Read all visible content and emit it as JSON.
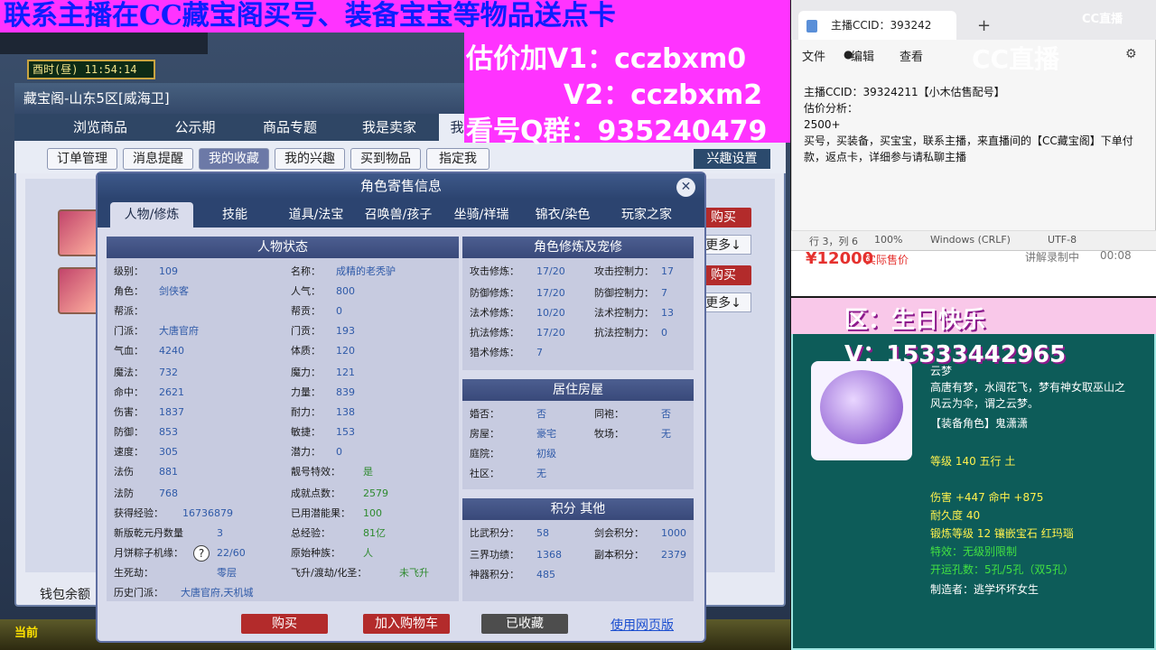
{
  "game": {
    "time_label": "酉时(昼) 11:54:14",
    "window_title": "藏宝阁-山东5区[威海卫]",
    "main_tabs": [
      "浏览商品",
      "公示期",
      "商品专题",
      "我是卖家",
      "我"
    ],
    "sub_tabs": [
      "订单管理",
      "消息提醒",
      "我的收藏",
      "我的兴趣",
      "买到物品",
      "指定我"
    ],
    "active_sub_tab": "我的收藏",
    "remind_settings": "兴趣设置",
    "side_buy": "购买",
    "side_more": "更多↓",
    "wallet_label": "钱包余额",
    "bottom_label": "当前"
  },
  "dialog": {
    "title": "角色寄售信息",
    "close": "✕",
    "tabs": [
      "人物/修炼",
      "技能",
      "道具/法宝",
      "召唤兽/孩子",
      "坐骑/祥瑞",
      "锦衣/染色",
      "玩家之家"
    ],
    "status_head": "人物状态",
    "cultivation_head": "角色修炼及宠修",
    "house_head": "居住房屋",
    "points_head": "积分 其他",
    "left_col": [
      {
        "label": "级别：",
        "value": "109"
      },
      {
        "label": "角色：",
        "value": "剑侠客"
      },
      {
        "label": "帮派：",
        "value": ""
      },
      {
        "label": "门派：",
        "value": "大唐官府"
      },
      {
        "label": "气血：",
        "value": "4240"
      },
      {
        "label": "魔法：",
        "value": "732"
      },
      {
        "label": "命中：",
        "value": "2621"
      },
      {
        "label": "伤害：",
        "value": "1837"
      },
      {
        "label": "防御：",
        "value": "853"
      },
      {
        "label": "速度：",
        "value": "305"
      },
      {
        "label": "法伤",
        "value": "881"
      },
      {
        "label": "法防",
        "value": "768"
      },
      {
        "label": "获得经验：",
        "value": "16736879"
      },
      {
        "label": "新版乾元丹数量",
        "value": "3"
      },
      {
        "label": "月饼粽子机缘：",
        "value": "22/60"
      },
      {
        "label": "生死劫：",
        "value": "零层"
      },
      {
        "label": "历史门派：",
        "value": "大唐官府,天机城"
      }
    ],
    "mid_col": [
      {
        "label": "名称：",
        "value": "成精的老秃驴"
      },
      {
        "label": "人气：",
        "value": "800"
      },
      {
        "label": "帮贡：",
        "value": "0"
      },
      {
        "label": "门贡：",
        "value": "193"
      },
      {
        "label": "体质：",
        "value": "120"
      },
      {
        "label": "魔力：",
        "value": "121"
      },
      {
        "label": "力量：",
        "value": "839"
      },
      {
        "label": "耐力：",
        "value": "138"
      },
      {
        "label": "敏捷：",
        "value": "153"
      },
      {
        "label": "潜力：",
        "value": "0"
      },
      {
        "label": "靓号特效：",
        "value": "是"
      },
      {
        "label": "成就点数：",
        "value": "2579"
      },
      {
        "label": "已用潜能果：",
        "value": "100"
      },
      {
        "label": "总经验：",
        "value": "81亿"
      },
      {
        "label": "原始种族：",
        "value": "人"
      },
      {
        "label": "飞升/渡劫/化圣：",
        "value": "未飞升"
      }
    ],
    "cultivation": [
      {
        "label": "攻击修炼：",
        "value": "17/20",
        "label2": "攻击控制力：",
        "value2": "17"
      },
      {
        "label": "防御修炼：",
        "value": "17/20",
        "label2": "防御控制力：",
        "value2": "7"
      },
      {
        "label": "法术修炼：",
        "value": "10/20",
        "label2": "法术控制力：",
        "value2": "13"
      },
      {
        "label": "抗法修炼：",
        "value": "17/20",
        "label2": "抗法控制力：",
        "value2": "0"
      },
      {
        "label": "猎术修炼：",
        "value": "7",
        "label2": "",
        "value2": ""
      }
    ],
    "house": [
      {
        "label": "婚否：",
        "value": "否",
        "label2": "同袍：",
        "value2": "否"
      },
      {
        "label": "房屋：",
        "value": "豪宅",
        "label2": "牧场：",
        "value2": "无"
      },
      {
        "label": "庭院：",
        "value": "初级",
        "label2": "",
        "value2": ""
      },
      {
        "label": "社区：",
        "value": "无",
        "label2": "",
        "value2": ""
      }
    ],
    "points": [
      {
        "label": "比武积分：",
        "value": "58",
        "label2": "剑会积分：",
        "value2": "1000"
      },
      {
        "label": "三界功绩：",
        "value": "1368",
        "label2": "副本积分：",
        "value2": "2379"
      },
      {
        "label": "神器积分：",
        "value": "485",
        "label2": "",
        "value2": ""
      }
    ],
    "buttons": {
      "buy": "购买",
      "add_cart": "加入购物车",
      "collected": "已收藏",
      "web": "使用网页版"
    }
  },
  "promo": {
    "top": "联系主播在CC藏宝阁买号、装备宝宝等物品送点卡",
    "line1": "估价加V1：cczbxm0",
    "line2": "V2：cczbxm2",
    "line3": "看号Q群：935240479"
  },
  "notepad": {
    "tab_title": "主播CCID：393242",
    "tab_dot": "●",
    "tab_close": "✕",
    "new_tab": "+",
    "menu": [
      "文件",
      "编辑",
      "查看"
    ],
    "text": "主播CCID：39324211【小木估售配号】\n估价分析：\n2500+\n买号，买装备，买宝宝，联系主播，来直播间的【CC藏宝阁】下单付款，返点卡，详细参与请私聊主播",
    "status": [
      "行 3，列 6",
      "100%",
      "Windows (CRLF)",
      "UTF-8"
    ],
    "cc_logo": "CC直播"
  },
  "listing": {
    "price": "¥12000",
    "price_sub": "实际售价",
    "status": "讲解录制中",
    "time": "00:08"
  },
  "item": {
    "zone": "区：生日快乐",
    "contact": "V：15333442965",
    "name": "云梦",
    "desc1": "高唐有梦，水阔花飞，梦有神女取巫山之",
    "desc2": "风云为伞，谓之云梦。",
    "role": "【装备角色】鬼潇潇",
    "level": "等级 140  五行 土",
    "stats": "伤害 +447  命中 +875",
    "durability": "耐久度 40",
    "forge": "锻炼等级 12  镶嵌宝石 红玛瑙",
    "effect": "特效：无级别限制",
    "holes": "开运孔数：5孔/5孔（双5孔）",
    "maker": "制造者：逃学坏坏女生"
  }
}
